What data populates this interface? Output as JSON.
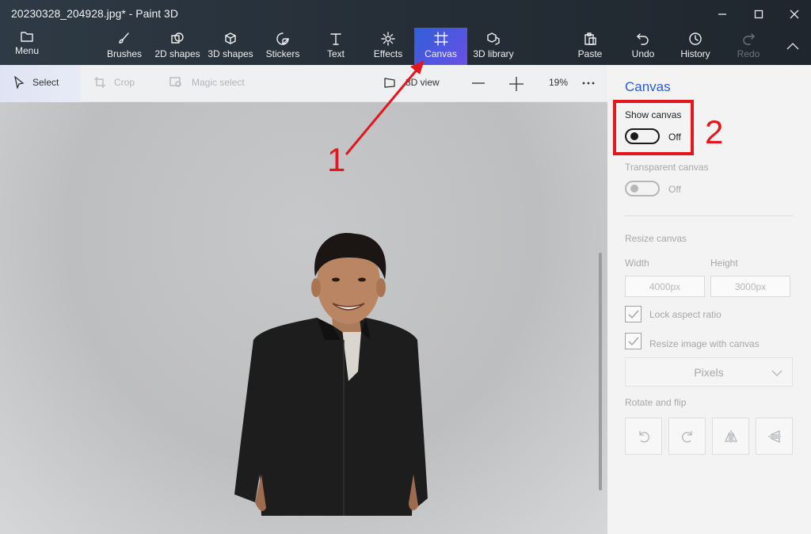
{
  "window": {
    "title": "20230328_204928.jpg* - Paint 3D",
    "controls": {
      "minimize_icon": "minimize-icon",
      "maximize_icon": "maximize-icon",
      "close_icon": "close-icon"
    }
  },
  "ribbon": {
    "menu": "Menu",
    "tools": [
      "Brushes",
      "2D shapes",
      "3D shapes",
      "Stickers",
      "Text",
      "Effects",
      "Canvas",
      "3D library"
    ],
    "active_tool": "Canvas",
    "right": [
      "Paste",
      "Undo",
      "History",
      "Redo"
    ],
    "disabled": [
      "Redo"
    ],
    "active_color": "#3b5bdb"
  },
  "subtoolbar": {
    "select": "Select",
    "crop": "Crop",
    "magic_select": "Magic select",
    "view_3d": "3D view",
    "zoom": "19%"
  },
  "panel": {
    "title": "Canvas",
    "show_canvas": {
      "label": "Show canvas",
      "state": "Off"
    },
    "transparent_canvas": {
      "label": "Transparent canvas",
      "state": "Off"
    },
    "resize": {
      "heading": "Resize canvas",
      "width_label": "Width",
      "height_label": "Height",
      "width_value": "4000px",
      "height_value": "3000px",
      "lock_aspect": "Lock aspect ratio",
      "resize_image": "Resize image with canvas",
      "units": "Pixels"
    },
    "rotate_flip": {
      "heading": "Rotate and flip"
    }
  },
  "annotations": {
    "step1": "1",
    "step2": "2",
    "color": "#e3171d"
  }
}
